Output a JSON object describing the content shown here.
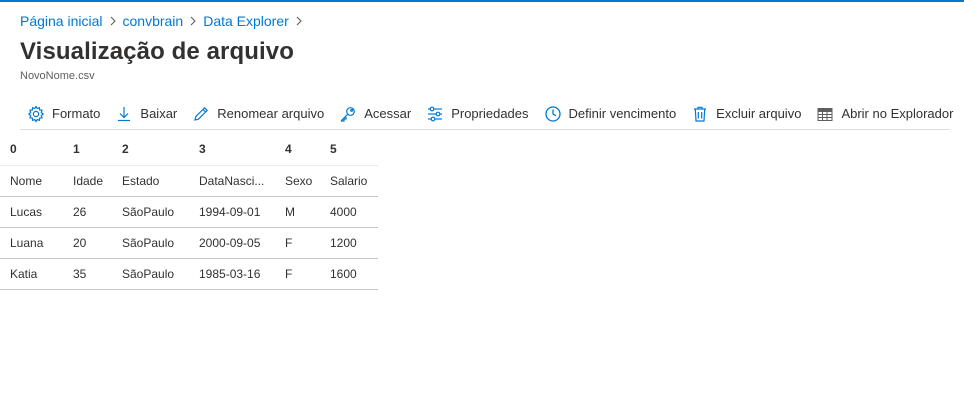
{
  "breadcrumb": [
    {
      "label": "Página inicial"
    },
    {
      "label": "convbrain"
    },
    {
      "label": "Data Explorer"
    }
  ],
  "page": {
    "title": "Visualização de arquivo",
    "subtitle": "NovoNome.csv"
  },
  "toolbar": {
    "items": [
      {
        "label": "Formato",
        "icon": "gear-icon"
      },
      {
        "label": "Baixar",
        "icon": "download-icon"
      },
      {
        "label": "Renomear arquivo",
        "icon": "pencil-icon"
      },
      {
        "label": "Acessar",
        "icon": "key-icon"
      },
      {
        "label": "Propriedades",
        "icon": "sliders-icon"
      },
      {
        "label": "Definir vencimento",
        "icon": "clock-icon"
      },
      {
        "label": "Excluir arquivo",
        "icon": "trash-icon"
      },
      {
        "label": "Abrir no Explorador",
        "icon": "explorer-icon"
      }
    ]
  },
  "colors": {
    "accent": "#0078d4",
    "text": "#323130"
  },
  "grid": {
    "column_indices": [
      "0",
      "1",
      "2",
      "3",
      "4",
      "5"
    ],
    "rows": [
      [
        "Nome",
        "Idade",
        "Estado",
        "DataNasci...",
        "Sexo",
        "Salario"
      ],
      [
        "Lucas",
        "26",
        "SãoPaulo",
        "1994-09-01",
        "M",
        "4000"
      ],
      [
        "Luana",
        "20",
        "SãoPaulo",
        "2000-09-05",
        "F",
        "1200"
      ],
      [
        "Katia",
        "35",
        "SãoPaulo",
        "1985-03-16",
        "F",
        "1600"
      ]
    ]
  }
}
